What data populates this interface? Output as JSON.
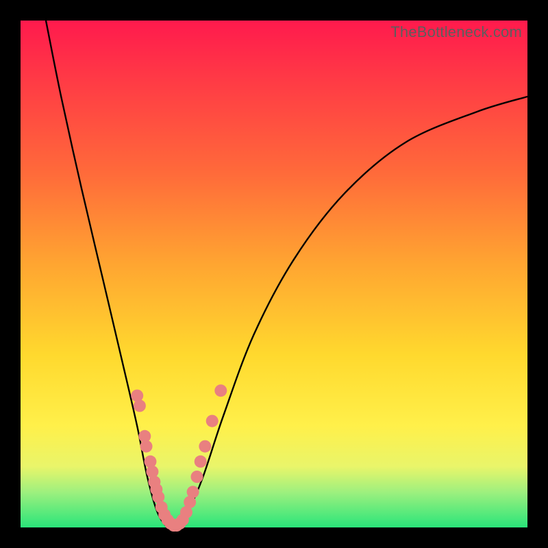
{
  "watermark": "TheBottleneck.com",
  "gradient_colors": {
    "top": "#ff1a4d",
    "upper_mid": "#ff6a3a",
    "mid": "#ffd92e",
    "lower_mid": "#fff04a",
    "bottom": "#29e57a"
  },
  "chart_data": {
    "type": "line",
    "title": "",
    "xlabel": "",
    "ylabel": "",
    "xlim": [
      0,
      100
    ],
    "ylim": [
      0,
      100
    ],
    "series": [
      {
        "name": "bottleneck-curve",
        "x": [
          5,
          8,
          12,
          16,
          20,
          23,
          25,
          27,
          29,
          30,
          31,
          33,
          36,
          40,
          46,
          54,
          64,
          76,
          90,
          100
        ],
        "y": [
          100,
          85,
          67,
          50,
          33,
          20,
          10,
          3,
          0,
          0,
          0,
          3,
          10,
          22,
          38,
          53,
          66,
          76,
          82,
          85
        ]
      }
    ],
    "scatter_points": {
      "name": "sample-dots",
      "color": "#e98080",
      "points": [
        {
          "x": 23.0,
          "y": 26
        },
        {
          "x": 23.5,
          "y": 24
        },
        {
          "x": 24.5,
          "y": 18
        },
        {
          "x": 24.8,
          "y": 16
        },
        {
          "x": 25.6,
          "y": 13
        },
        {
          "x": 26.0,
          "y": 11
        },
        {
          "x": 26.4,
          "y": 9
        },
        {
          "x": 26.8,
          "y": 7.5
        },
        {
          "x": 27.2,
          "y": 6
        },
        {
          "x": 27.8,
          "y": 4
        },
        {
          "x": 28.4,
          "y": 2.5
        },
        {
          "x": 29.0,
          "y": 1.5
        },
        {
          "x": 29.6,
          "y": 0.8
        },
        {
          "x": 30.2,
          "y": 0.4
        },
        {
          "x": 30.8,
          "y": 0.4
        },
        {
          "x": 31.4,
          "y": 0.8
        },
        {
          "x": 32.0,
          "y": 1.5
        },
        {
          "x": 32.7,
          "y": 3
        },
        {
          "x": 33.4,
          "y": 5
        },
        {
          "x": 34.0,
          "y": 7
        },
        {
          "x": 34.8,
          "y": 10
        },
        {
          "x": 35.5,
          "y": 13
        },
        {
          "x": 36.4,
          "y": 16
        },
        {
          "x": 37.8,
          "y": 21
        },
        {
          "x": 39.5,
          "y": 27
        }
      ]
    }
  }
}
